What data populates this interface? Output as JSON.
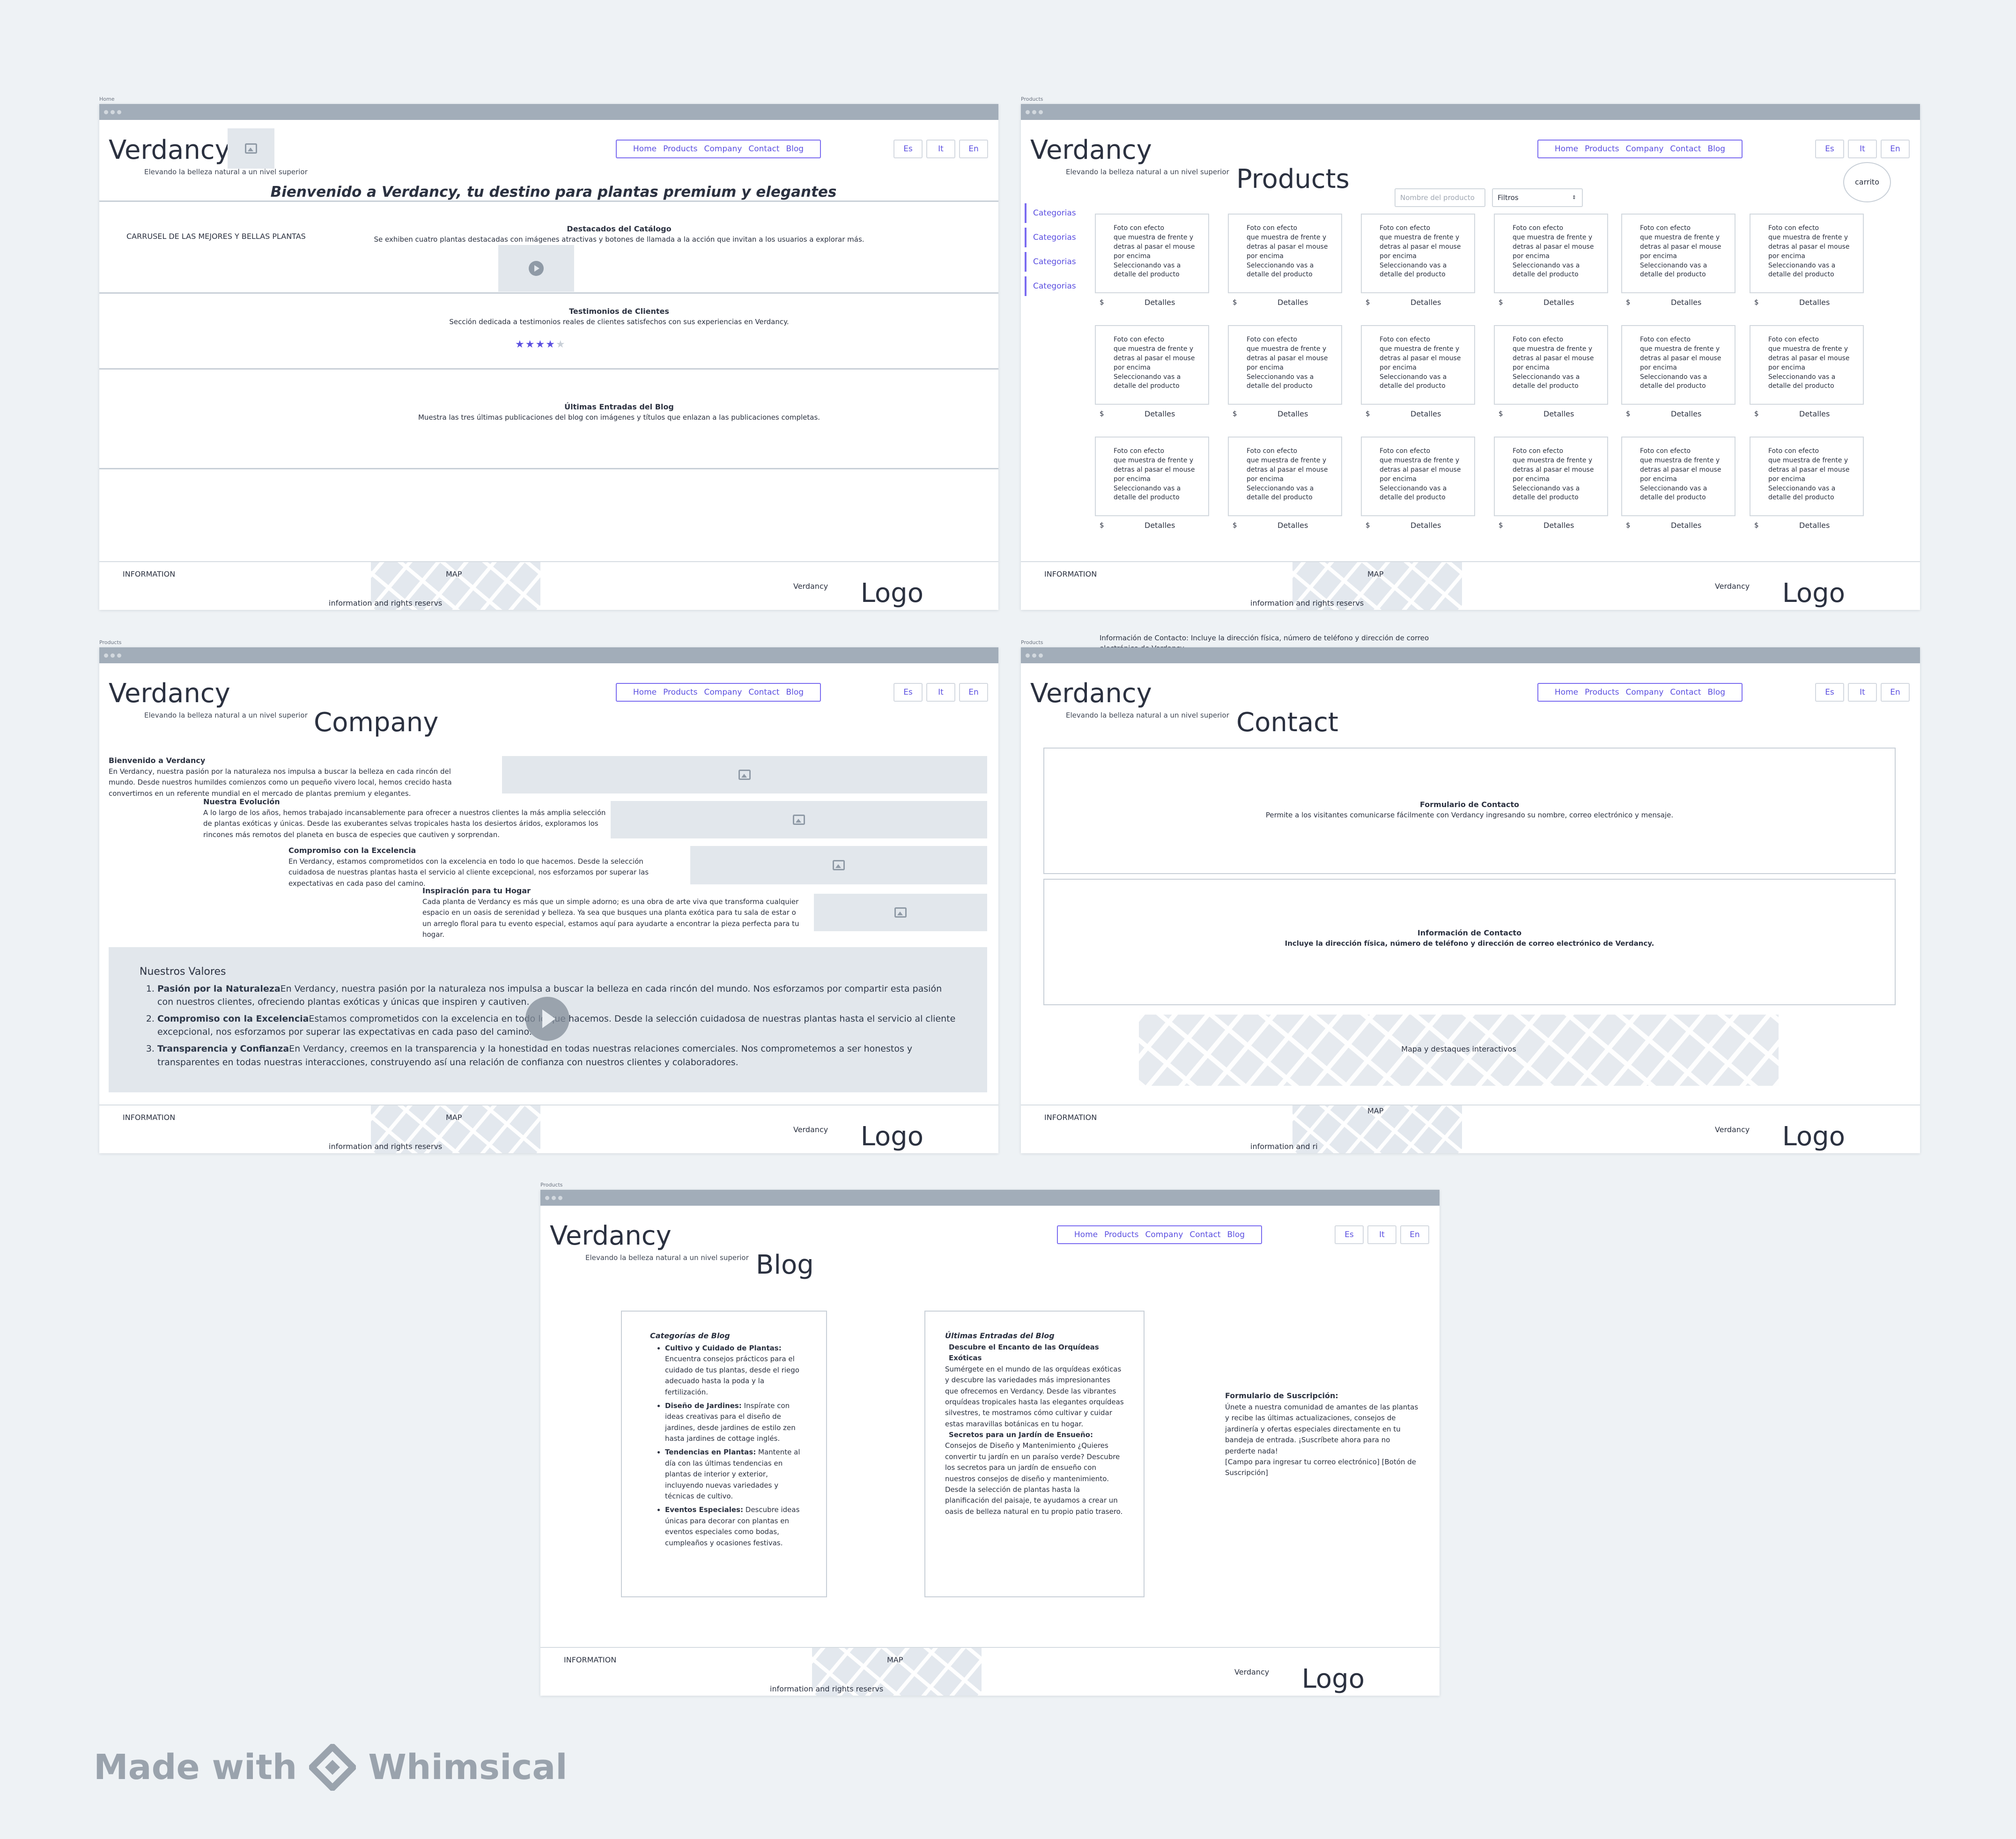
{
  "common": {
    "brand": "Verdancy",
    "tagline": "Elevando la belleza natural a un nivel superior",
    "nav": [
      "Home",
      "Products",
      "Company",
      "Contact",
      "Blog"
    ],
    "langs": [
      "Es",
      "It",
      "En"
    ],
    "footer": {
      "information": "INFORMATION",
      "map": "MAP",
      "rights": "information and rights reservs",
      "verdancy": "Verdancy",
      "logo": "Logo"
    }
  },
  "frame_labels": {
    "home": "Home",
    "products": "Products",
    "company": "Products",
    "contact": "Products",
    "blog": "Products"
  },
  "home": {
    "hero": "Bienvenido a Verdancy, tu destino para plantas premium y elegantes",
    "carousel": "CARRUSEL DE LAS MEJORES Y BELLAS PLANTAS",
    "catalog_title": "Destacados del Catálogo",
    "catalog_text": "Se exhiben cuatro plantas destacadas con imágenes atractivas y botones de llamada a la acción que invitan a los usuarios a explorar más.",
    "testimonials_title": "Testimonios de Clientes",
    "testimonials_text": "Sección dedicada a testimonios reales de clientes satisfechos con sus experiencias en Verdancy.",
    "rating": "★★★★",
    "rating_empty": "★",
    "blog_title": "Últimas Entradas del Blog",
    "blog_text": "Muestra las tres últimas publicaciones del blog con imágenes y títulos que enlazan a las publicaciones completas."
  },
  "products": {
    "title": "Products",
    "search_placeholder": "Nombre del producto",
    "filters": "Filtros",
    "cart": "carrito",
    "categories": [
      "Categorias",
      "Categorias",
      "Categorias",
      "Categorias"
    ],
    "card_lines": [
      "Foto con efecto",
      "que muestra de frente  y",
      "detras al pasar el mouse",
      "por encima",
      "Seleccionando vas a",
      "detalle del producto"
    ],
    "price": "$",
    "details": "Detalles"
  },
  "company": {
    "title": "Company",
    "sections": [
      {
        "title": "Bienvenido a Verdancy",
        "text": "En Verdancy, nuestra pasión por la naturaleza nos impulsa a buscar la belleza en cada rincón del mundo. Desde nuestros humildes comienzos como un pequeño vivero local, hemos crecido hasta convertirnos en un referente mundial en el mercado de plantas premium y elegantes."
      },
      {
        "title": "Nuestra Evolución",
        "text": "A lo largo de los años, hemos trabajado incansablemente para ofrecer a nuestros clientes la más amplia selección de plantas exóticas y únicas. Desde las exuberantes selvas tropicales hasta los desiertos áridos, exploramos los rincones más remotos del planeta en busca de especies que cautiven y sorprendan."
      },
      {
        "title": "Compromiso con la Excelencia",
        "text": "En Verdancy, estamos comprometidos con la excelencia en todo lo que hacemos. Desde la selección cuidadosa de nuestras plantas hasta el servicio al cliente excepcional, nos esforzamos por superar las expectativas en cada paso del camino."
      },
      {
        "title": "Inspiración para tu Hogar",
        "text": "Cada planta de Verdancy es más que un simple adorno; es una obra de arte viva que transforma cualquier espacio en un oasis de serenidad y belleza. Ya sea que busques una planta exótica para tu sala de estar o un arreglo floral para tu evento especial, estamos aquí para ayudarte a encontrar la pieza perfecta para tu hogar."
      }
    ],
    "values_title": "Nuestros Valores",
    "values": [
      {
        "bold": "Pasión por la Naturaleza",
        "text": "En Verdancy, nuestra pasión por la naturaleza nos impulsa a buscar la belleza en cada rincón del mundo. Nos esforzamos por compartir esta pasión con nuestros clientes, ofreciendo plantas exóticas y únicas que inspiren y cautiven."
      },
      {
        "bold": "Compromiso con la Excelencia",
        "text": "Estamos comprometidos con la excelencia en todo lo que hacemos. Desde la selección cuidadosa de nuestras plantas hasta el servicio al cliente excepcional, nos esforzamos por superar las expectativas en cada paso del camino."
      },
      {
        "bold": "Transparencia y Confianza",
        "text": "En Verdancy, creemos en la transparencia y la honestidad en todas nuestras relaciones comerciales. Nos comprometemos a ser honestos y transparentes en todas nuestras interacciones, construyendo así una relación de confianza con nuestros clientes y colaboradores."
      }
    ]
  },
  "contact": {
    "title": "Contact",
    "note": "Información de Contacto: Incluye la dirección física, número de teléfono y dirección de correo electrónico de Verdancy.",
    "form_title": "Formulario de Contacto",
    "form_text": "Permite a los visitantes comunicarse fácilmente con Verdancy ingresando su nombre, correo electrónico y mensaje.",
    "info_title": "Información de Contacto",
    "info_text": "Incluye la dirección física, número de teléfono y dirección de correo electrónico de Verdancy.",
    "map_text": "Mapa y destaques interactivos",
    "footer_rights": "information and ri",
    "footer_map": "MAP"
  },
  "blog": {
    "title": "Blog",
    "categories_title": "Categorías de Blog",
    "categories": [
      {
        "bold": "Cultivo y Cuidado de Plantas:",
        "text": "Encuentra consejos prácticos para el cuidado de tus plantas, desde el riego adecuado hasta la poda y la fertilización."
      },
      {
        "bold": "Diseño de Jardines:",
        "text": "Inspírate con ideas creativas para el diseño de jardines, desde jardines de estilo zen hasta jardines de cottage inglés."
      },
      {
        "bold": "Tendencias en Plantas:",
        "text": "Mantente al día con las últimas tendencias en plantas de interior y exterior, incluyendo nuevas variedades y técnicas de cultivo."
      },
      {
        "bold": "Eventos Especiales:",
        "text": "Descubre ideas únicas para decorar con plantas en eventos especiales como bodas, cumpleaños y ocasiones festivas."
      }
    ],
    "latest_title": "Últimas Entradas del Blog",
    "post1_title": "Descubre el Encanto de las Orquídeas Exóticas",
    "post1_text": "Sumérgete en el mundo de las orquídeas exóticas y descubre las variedades más impresionantes que ofrecemos en Verdancy. Desde las vibrantes orquídeas tropicales hasta las elegantes orquídeas silvestres, te mostramos cómo cultivar y cuidar estas maravillas botánicas en tu hogar.",
    "post2_title": "Secretos para un Jardín de Ensueño:",
    "post2_text": "Consejos de Diseño y Mantenimiento ¿Quieres convertir tu jardín en un paraíso verde? Descubre los secretos para un jardín de ensueño con nuestros consejos de diseño y mantenimiento. Desde la selección de plantas hasta la planificación del paisaje, te ayudamos a crear un oasis de belleza natural en tu propio patio trasero.",
    "subscribe_title": "Formulario de Suscripción:",
    "subscribe_text": "Únete a nuestra comunidad de amantes de las plantas y recibe las últimas actualizaciones, consejos de jardinería y ofertas especiales directamente en tu bandeja de entrada. ¡Suscríbete ahora para no perderte nada!",
    "subscribe_fields": "[Campo para ingresar tu correo electrónico] [Botón de Suscripción]"
  },
  "watermark": {
    "made_with": "Made with",
    "product": "Whimsical"
  }
}
